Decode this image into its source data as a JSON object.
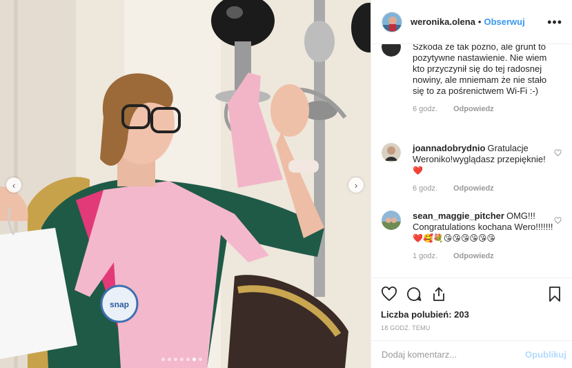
{
  "post": {
    "username": "weronika.olena",
    "bullet": "•",
    "follow_label": "Obserwuj",
    "more_icon": "more-options-icon",
    "carousel": {
      "prev_icon": "chevron-left-icon",
      "next_icon": "chevron-right-icon",
      "slide_count": 7,
      "active_slide": 6
    }
  },
  "comments": [
    {
      "user": "",
      "text": "Szkoda że tak późno, ale grunt to pozytywne nastawienie. Nie wiem kto przyczynił się do tej radosnej nowiny, ale mniemam że nie stało się to za pośrenictwem Wi-Fi :-)",
      "time": "6 godz.",
      "reply": "Odpowiedz"
    },
    {
      "user": "joannadobrydnio",
      "text": "Gratulacje Weroniko!wyglądasz przepięknie!",
      "emoji": "❤️",
      "time": "6 godz.",
      "reply": "Odpowiedz"
    },
    {
      "user": "sean_maggie_pitcher",
      "text": "OMG!!! Congratulations kochana Wero!!!!!!!",
      "emoji": "❤️🥰💐😘😘😘😘😘😘",
      "time": "1 godz.",
      "reply": "Odpowiedz"
    }
  ],
  "actions": {
    "likes_label": "Liczba polubień: 203",
    "timestamp": "18 GODZ. TEMU"
  },
  "add_comment": {
    "placeholder": "Dodaj komentarz...",
    "publish_label": "Opublikuj"
  },
  "colors": {
    "accent": "#3897f0",
    "publish_disabled": "#b3dbff",
    "meta": "#999999",
    "heart_red": "#ed4956"
  }
}
